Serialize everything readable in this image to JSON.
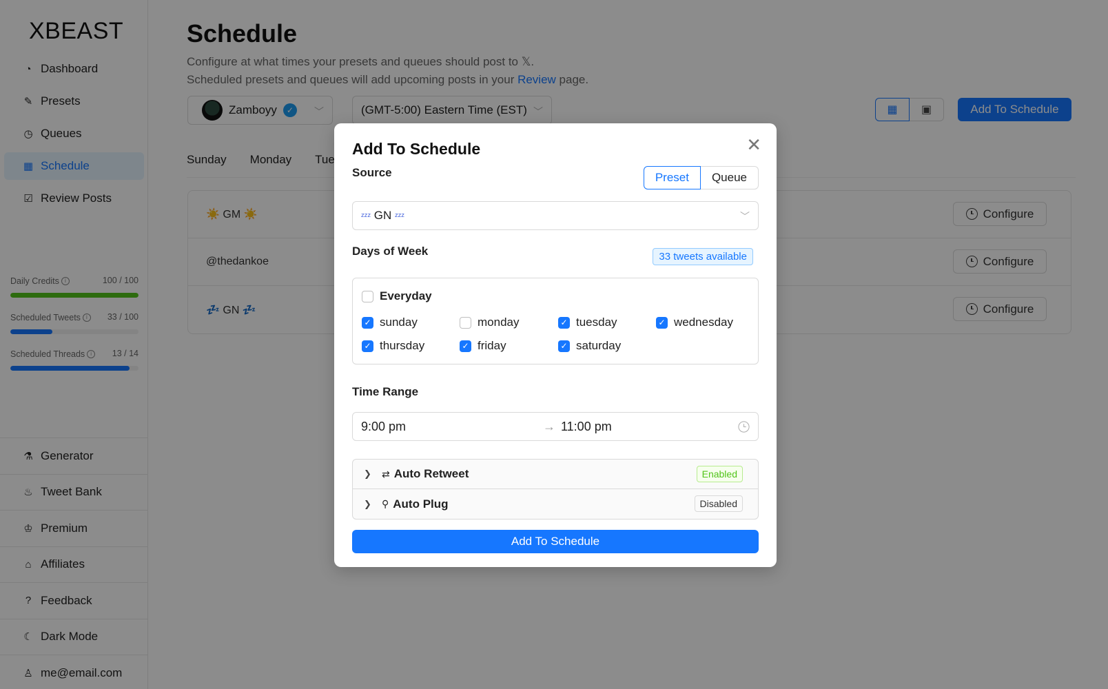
{
  "sidebar": {
    "logo": "XBEAST",
    "nav": [
      {
        "label": "Dashboard",
        "icon": "dashboard-icon",
        "glyph": "◔"
      },
      {
        "label": "Presets",
        "icon": "edit-icon",
        "glyph": "✎"
      },
      {
        "label": "Queues",
        "icon": "history-icon",
        "glyph": "◷"
      },
      {
        "label": "Schedule",
        "icon": "calendar-icon",
        "glyph": "▦"
      },
      {
        "label": "Review Posts",
        "icon": "check-square-icon",
        "glyph": "☑"
      }
    ],
    "active": "Schedule",
    "credits": [
      {
        "label": "Daily Credits",
        "value": "100 / 100",
        "fraction": 1.0,
        "color": "#52c41a"
      },
      {
        "label": "Scheduled Tweets",
        "value": "33 / 100",
        "fraction": 0.33,
        "color": "#1677ff"
      },
      {
        "label": "Scheduled Threads",
        "value": "13 / 14",
        "fraction": 0.93,
        "color": "#1677ff"
      }
    ],
    "bottom_nav": [
      {
        "label": "Generator",
        "icon": "flask-icon",
        "glyph": "⚗"
      },
      {
        "label": "Tweet Bank",
        "icon": "fire-icon",
        "glyph": "♨"
      },
      {
        "label": "Premium",
        "icon": "bell-icon",
        "glyph": "♔"
      },
      {
        "label": "Affiliates",
        "icon": "bank-icon",
        "glyph": "⌂"
      },
      {
        "label": "Feedback",
        "icon": "question-icon",
        "glyph": "?"
      },
      {
        "label": "Dark Mode",
        "icon": "moon-icon",
        "glyph": "☾"
      },
      {
        "label": "me@email.com",
        "icon": "user-icon",
        "glyph": "♙"
      }
    ]
  },
  "header": {
    "title": "Schedule",
    "desc_line1": "Configure at what times your presets and queues should post to 𝕏.",
    "desc_line2_prefix": "Scheduled presets and queues will add upcoming posts in your ",
    "desc_link": "Review",
    "desc_line2_suffix": " page."
  },
  "toolbar": {
    "account": "Zamboyy",
    "timezone": "(GMT-5:00) Eastern Time (EST)",
    "add_button": "Add To Schedule"
  },
  "day_tabs": [
    "Sunday",
    "Monday",
    "Tue"
  ],
  "schedule_rows": [
    {
      "label": "☀️ GM ☀️",
      "button": "Configure"
    },
    {
      "label": "@thedankoe",
      "button": "Configure"
    },
    {
      "label": "💤 GN 💤",
      "button": "Configure"
    }
  ],
  "modal": {
    "title": "Add To Schedule",
    "source_label": "Source",
    "source_options": [
      "Preset",
      "Queue"
    ],
    "source_selected": "Preset",
    "source_value": "GN",
    "days_label": "Days of Week",
    "tweets_available": "33 tweets available",
    "everyday": {
      "label": "Everyday",
      "checked": false
    },
    "days": [
      {
        "label": "sunday",
        "checked": true
      },
      {
        "label": "monday",
        "checked": false
      },
      {
        "label": "tuesday",
        "checked": true
      },
      {
        "label": "wednesday",
        "checked": true
      },
      {
        "label": "thursday",
        "checked": true
      },
      {
        "label": "friday",
        "checked": true
      },
      {
        "label": "saturday",
        "checked": true
      }
    ],
    "time_label": "Time Range",
    "time_start": "9:00 pm",
    "time_end": "11:00 pm",
    "auto_retweet": {
      "label": "Auto Retweet",
      "status": "Enabled"
    },
    "auto_plug": {
      "label": "Auto Plug",
      "status": "Disabled"
    },
    "submit": "Add To Schedule"
  }
}
